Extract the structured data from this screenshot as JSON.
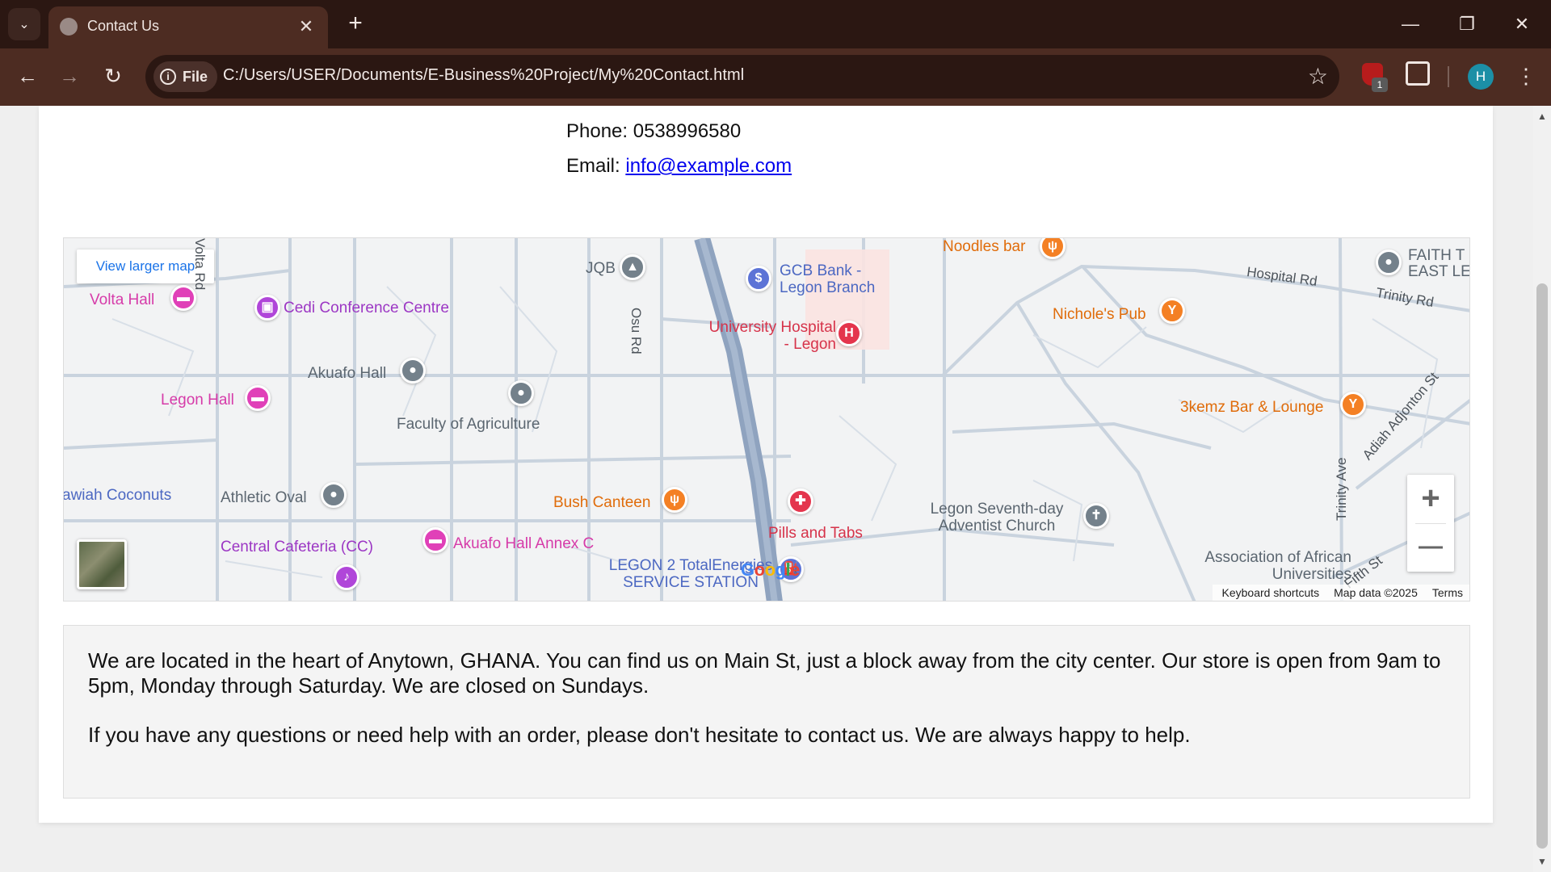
{
  "browser": {
    "tab_title": "Contact Us",
    "tab_close": "✕",
    "new_tab": "+",
    "minimize": "—",
    "restore": "❐",
    "close": "✕",
    "back": "←",
    "forward": "→",
    "reload": "↻",
    "chip_label": "File",
    "url": "C:/Users/USER/Documents/E-Business%20Project/My%20Contact.html",
    "bookmark_star": "☆",
    "extension_badge": "1",
    "avatar_letter": "H",
    "menu": "⋮"
  },
  "contact": {
    "phone_label": "Phone: ",
    "phone": "0538996580",
    "email_label": "Email: ",
    "email": "info@example.com"
  },
  "map": {
    "larger_map_link": "View larger map",
    "zoom_in": "+",
    "zoom_out": "—",
    "footer": {
      "shortcuts": "Keyboard shortcuts",
      "map_data": "Map data ©2025",
      "terms": "Terms"
    },
    "logo": "Google",
    "places": [
      {
        "name": "Volta Hall",
        "category": "lodging"
      },
      {
        "name": "Cedi Conference Centre",
        "category": "event"
      },
      {
        "name": "Akuafo Hall",
        "category": "landmark"
      },
      {
        "name": "Legon Hall",
        "category": "lodging"
      },
      {
        "name": "Faculty of Agriculture",
        "category": "landmark"
      },
      {
        "name": "JQB",
        "category": "school"
      },
      {
        "name": "GCB Bank - Legon Branch",
        "category": "bank"
      },
      {
        "name": "University Hospital - Legon",
        "category": "hospital"
      },
      {
        "name": "Noodles bar",
        "category": "food"
      },
      {
        "name": "Nichole's Pub",
        "category": "bar"
      },
      {
        "name": "3kemz Bar & Lounge",
        "category": "bar"
      },
      {
        "name": "FAITH T EAST LE",
        "category": "landmark"
      },
      {
        "name": "awiah Coconuts",
        "category": "shop"
      },
      {
        "name": "Athletic Oval",
        "category": "landmark"
      },
      {
        "name": "Central Cafeteria (CC)",
        "category": "music"
      },
      {
        "name": "Akuafo Hall Annex C",
        "category": "lodging"
      },
      {
        "name": "Bush Canteen",
        "category": "food"
      },
      {
        "name": "Pills and Tabs",
        "category": "pharmacy"
      },
      {
        "name": "LEGON 2 TotalEnergies SERVICE STATION",
        "category": "fuel"
      },
      {
        "name": "Legon Seventh-day Adventist Church",
        "category": "church"
      },
      {
        "name": "Association of African Universities",
        "category": "landmark"
      }
    ],
    "roads": [
      "Volta Rd",
      "Osu Rd",
      "Hospital Rd",
      "Trinity Rd",
      "Trinity Ave",
      "Fifth St",
      "Adiah Adjonton St",
      "Rd"
    ]
  },
  "about": {
    "paragraph1": "We are located in the heart of Anytown, GHANA. You can find us on Main St, just a block away from the city center. Our store is open from 9am to 5pm, Monday through Saturday. We are closed on Sundays.",
    "paragraph2": "If you have any questions or need help with an order, please don't hesitate to contact us. We are always happy to help."
  },
  "colors": {
    "chrome_dark": "#2b1712",
    "chrome_toolbar": "#4d2c22",
    "link": "#0000ee",
    "map_bg": "#f2f3f4",
    "major_road": "#8fa3bf"
  }
}
